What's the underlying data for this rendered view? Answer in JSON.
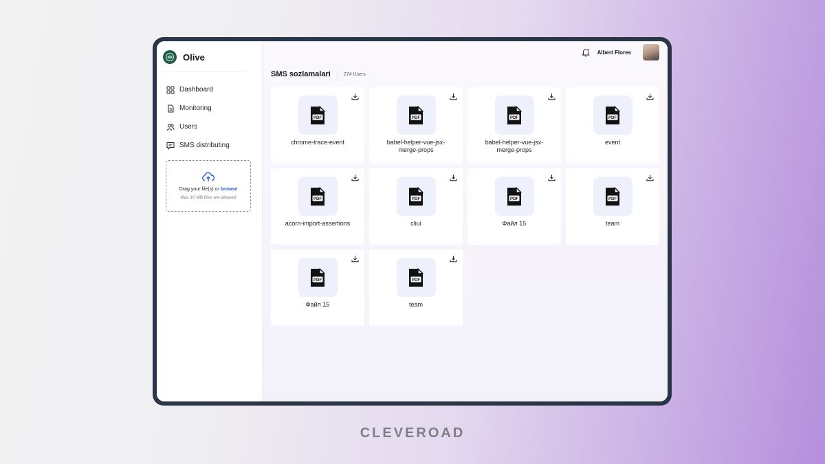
{
  "app": {
    "name": "Olive"
  },
  "sidebar": {
    "items": [
      {
        "label": "Dashboard",
        "icon": "dashboard-icon"
      },
      {
        "label": "Monitoring",
        "icon": "document-icon"
      },
      {
        "label": "Users",
        "icon": "users-icon"
      },
      {
        "label": "SMS distributing",
        "icon": "message-icon"
      }
    ],
    "upload": {
      "prompt": "Drag your file(s) or ",
      "browse": "browse",
      "limit": "Max 10 MB files are allowed"
    }
  },
  "header": {
    "user_name": "Albert Flores",
    "notification_color": "#e5484d"
  },
  "page": {
    "title": "SMS sozlamalari",
    "count": "274 Users"
  },
  "files": [
    {
      "name": "chrome-trace-event"
    },
    {
      "name": "babel-helper-vue-jsx-merge-props"
    },
    {
      "name": "babel-helper-vue-jsx-merge-props"
    },
    {
      "name": "event"
    },
    {
      "name": "acorn-import-assertions"
    },
    {
      "name": "cliui"
    },
    {
      "name": "Файл 15"
    },
    {
      "name": "team"
    },
    {
      "name": "Файл 15"
    },
    {
      "name": "team"
    }
  ],
  "branding": {
    "watermark": "CLEVEROAD"
  },
  "colors": {
    "accent": "#2c5cd6",
    "brand": "#1e5e4a",
    "frame": "#2a3646"
  }
}
